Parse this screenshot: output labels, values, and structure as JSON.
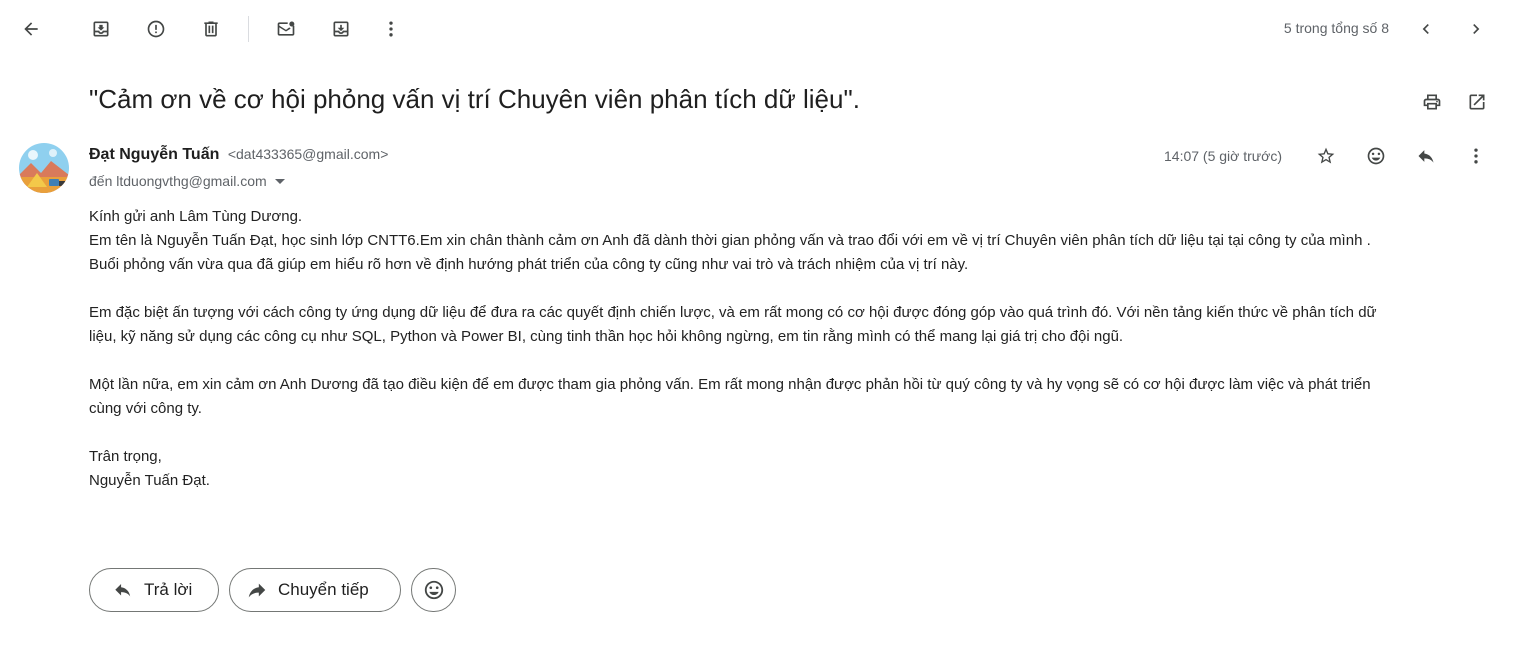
{
  "toolbar": {
    "back_icon": "arrow-left-icon",
    "archive_icon": "archive-icon",
    "report_spam_icon": "report-icon",
    "delete_icon": "trash-icon",
    "mark_unread_icon": "mark-unread-icon",
    "move_icon": "move-to-icon",
    "more_icon": "more-vert-icon",
    "pager": "5 trong tổng số 8",
    "prev_icon": "chevron-left-icon",
    "next_icon": "chevron-right-icon"
  },
  "subject": {
    "text": "\"Cảm ơn về cơ hội phỏng vấn vị trí Chuyên viên phân tích dữ liệu\".",
    "print_icon": "print-icon",
    "new_window_icon": "open-in-new-icon"
  },
  "message": {
    "sender_name": "Đạt Nguyễn Tuấn",
    "sender_email": "<dat433365@gmail.com>",
    "recipient": "đến ltduongvthg@gmail.com",
    "timestamp": "14:07 (5 giờ trước)",
    "star_icon": "star-icon",
    "emoji_icon": "emoji-icon",
    "reply_icon": "reply-icon",
    "more_icon": "more-vert-icon"
  },
  "body": {
    "greeting": "Kính gửi anh Lâm Tùng Dương.",
    "p1_line1": "Em tên là Nguyễn Tuấn Đạt, học sinh lớp CNTT6.Em xin chân thành cảm ơn Anh đã dành thời gian phỏng vấn và trao đổi với em về vị trí Chuyên viên phân tích dữ liệu tại tại công ty của mình .",
    "p1_line2": "Buổi phỏng vấn vừa qua đã giúp em hiểu rõ hơn về định hướng phát triển của công ty cũng như vai trò và trách nhiệm của vị trí này.",
    "p2_line1": "Em đặc biệt ấn tượng với cách công ty ứng dụng dữ liệu để đưa ra các quyết định chiến lược, và em rất mong có cơ hội được đóng góp vào quá trình đó. Với nền tảng kiến thức về phân tích dữ",
    "p2_line2": "liệu, kỹ năng sử dụng các công cụ như SQL, Python và Power BI, cùng tinh thần học hỏi không ngừng, em tin rằng mình có thể mang lại giá trị cho đội ngũ.",
    "p3_line1": "Một lần nữa, em xin cảm ơn Anh Dương đã tạo điều kiện để em được tham gia phỏng vấn. Em rất mong nhận được phản hồi từ quý công ty và hy vọng sẽ có cơ hội được làm việc và phát triển",
    "p3_line2": "cùng với công ty.",
    "closing": "Trân trọng,",
    "signature": "Nguyễn Tuấn Đạt."
  },
  "actions": {
    "reply_label": "Trả lời",
    "forward_label": "Chuyển tiếp",
    "emoji_icon": "emoji-icon"
  }
}
